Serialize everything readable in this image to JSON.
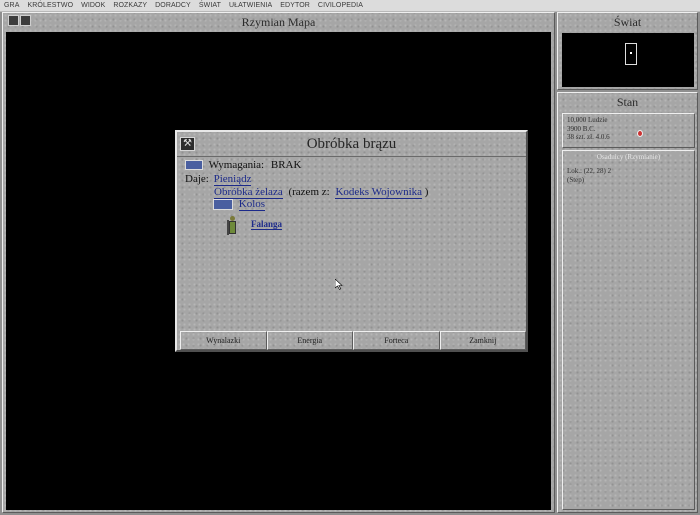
{
  "menu": {
    "items": [
      "GRA",
      "KRÓLESTWO",
      "WIDOK",
      "ROZKAZY",
      "DORADCY",
      "ŚWIAT",
      "UŁATWIENIA",
      "EDYTOR",
      "CIVILOPEDIA"
    ]
  },
  "map_panel": {
    "title": "Rzymian Mapa"
  },
  "world_panel": {
    "title": "Świat"
  },
  "status_panel": {
    "title": "Stan",
    "lines": [
      "10,000 Ludzie",
      "3900 B.C.",
      "38 szt. zł. 4.0.6"
    ]
  },
  "unit_panel": {
    "header": "Osadnicy (Rzymianie)",
    "lines": [
      "Lok.: (22, 28) 2",
      "(Step)"
    ]
  },
  "dialog": {
    "title": "Obróbka brązu",
    "requires_label": "Wymagania:",
    "requires_value": "BRAK",
    "gives_label": "Daje:",
    "gives_item": "Pieniądz",
    "combo_item": "Obróbka żelaza",
    "combo_prefix": "(razem z:",
    "combo_with": "Kodeks Wojownika",
    "combo_suffix": ")",
    "wonder": "Kolos",
    "unit": "Falanga",
    "buttons": [
      "Wynalazki",
      "Energia",
      "Forteca",
      "Zamknij"
    ]
  }
}
